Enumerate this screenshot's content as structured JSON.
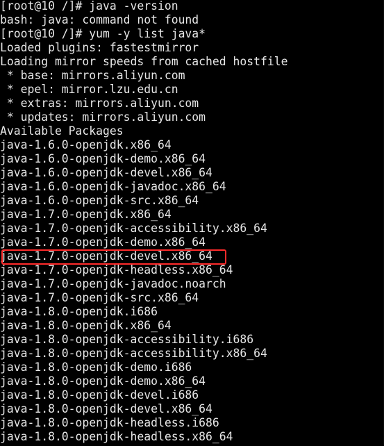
{
  "terminal": {
    "lines": [
      "[root@10 /]# java -version",
      "bash: java: command not found",
      "[root@10 /]# yum -y list java*",
      "Loaded plugins: fastestmirror",
      "Loading mirror speeds from cached hostfile",
      " * base: mirrors.aliyun.com",
      " * epel: mirror.lzu.edu.cn",
      " * extras: mirrors.aliyun.com",
      " * updates: mirrors.aliyun.com",
      "Available Packages",
      "java-1.6.0-openjdk.x86_64",
      "java-1.6.0-openjdk-demo.x86_64",
      "java-1.6.0-openjdk-devel.x86_64",
      "java-1.6.0-openjdk-javadoc.x86_64",
      "java-1.6.0-openjdk-src.x86_64",
      "java-1.7.0-openjdk.x86_64",
      "java-1.7.0-openjdk-accessibility.x86_64",
      "java-1.7.0-openjdk-demo.x86_64",
      "java-1.7.0-openjdk-devel.x86_64",
      "java-1.7.0-openjdk-headless.x86_64",
      "java-1.7.0-openjdk-javadoc.noarch",
      "java-1.7.0-openjdk-src.x86_64",
      "java-1.8.0-openjdk.i686",
      "java-1.8.0-openjdk.x86_64",
      "java-1.8.0-openjdk-accessibility.i686",
      "java-1.8.0-openjdk-accessibility.x86_64",
      "java-1.8.0-openjdk-demo.i686",
      "java-1.8.0-openjdk-demo.x86_64",
      "java-1.8.0-openjdk-devel.i686",
      "java-1.8.0-openjdk-devel.x86_64",
      "java-1.8.0-openjdk-headless.i686",
      "java-1.8.0-openjdk-headless.x86_64"
    ],
    "highlighted_line_index": 18
  },
  "colors": {
    "background": "#000000",
    "text": "#e6e6e6",
    "highlight": "#ff2b2b"
  }
}
